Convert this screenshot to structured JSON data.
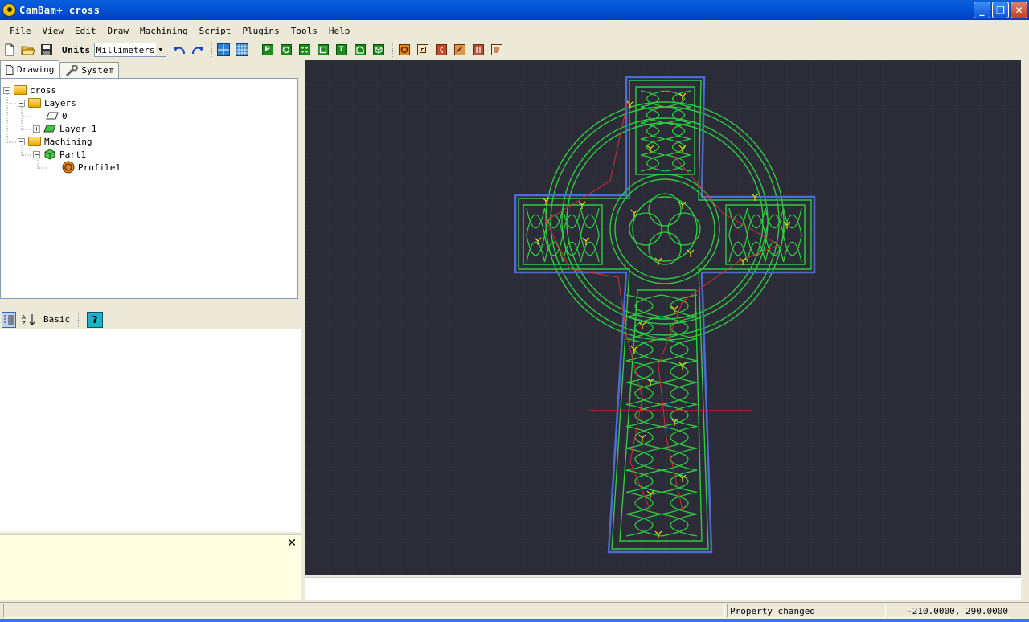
{
  "window": {
    "app_name": "CamBam+",
    "doc_name": "cross",
    "buttons": [
      "_",
      "❐",
      "✕"
    ]
  },
  "menu": [
    "File",
    "View",
    "Edit",
    "Draw",
    "Machining",
    "Script",
    "Plugins",
    "Tools",
    "Help"
  ],
  "toolbar": {
    "units_label": "Units",
    "units_value": "Millimeters",
    "icons": [
      "new-file-icon",
      "open-folder-icon",
      "save-icon",
      "undo-icon",
      "redo-icon",
      "snap-grid-icon",
      "grid-icon",
      "polyline-icon",
      "circle-icon",
      "points-icon",
      "rectangle-icon",
      "text-icon",
      "region-icon",
      "3d-surface-icon",
      "profile-icon",
      "pocket-icon",
      "drill-icon",
      "engrave-icon",
      "lathe-icon",
      "gcode-icon"
    ],
    "green_letters": [
      "P",
      "",
      "",
      "",
      "T",
      "",
      ""
    ]
  },
  "left_tabs": [
    "Drawing",
    "System"
  ],
  "tree": {
    "root": "cross",
    "layers_label": "Layers",
    "layer0": "0",
    "layer1": "Layer 1",
    "machining_label": "Machining",
    "part": "Part1",
    "profile": "Profile1"
  },
  "props_toolbar": {
    "basic_label": "Basic",
    "help_label": "?"
  },
  "info_close": "✕",
  "status": {
    "message": "Property changed",
    "coords": "-210.0000, 290.0000"
  },
  "colors": {
    "title_blue": "#0454d8",
    "canvas_bg": "#2c2c38",
    "path_green": "#2ecc40",
    "boundary_blue": "#4a6bd8",
    "toolpath_red": "#d03030",
    "marker_yellow": "#f2e000"
  }
}
